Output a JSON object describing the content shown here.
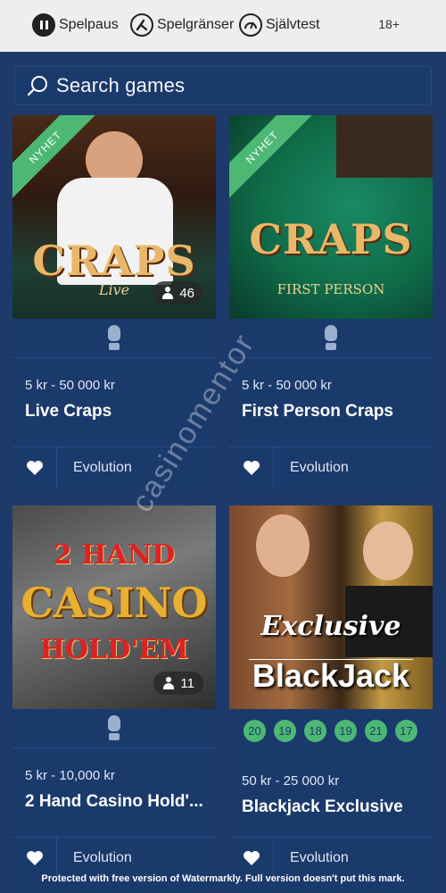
{
  "topbar": {
    "pause_label": "Spelpaus",
    "limits_label": "Spelgränser",
    "selftest_label": "Självtest",
    "age_label": "18+"
  },
  "search": {
    "placeholder": "Search games"
  },
  "badges": {
    "new_label": "NYHET"
  },
  "games": [
    {
      "price": "5 kr - 50 000 kr",
      "name": "Live Craps",
      "provider": "Evolution",
      "players": "46",
      "thumb_title": "CRAPS",
      "thumb_sub": "Live"
    },
    {
      "price": "5 kr - 50 000 kr",
      "name": "First Person Craps",
      "provider": "Evolution",
      "thumb_title": "CRAPS",
      "thumb_sub": "FIRST PERSON"
    },
    {
      "price": "5 kr - 10,000 kr",
      "name": "2 Hand Casino Hold'...",
      "provider": "Evolution",
      "players": "11",
      "thumb_line1": "2 HAND",
      "thumb_line2": "CASINO",
      "thumb_line3": "HOLD'EM"
    },
    {
      "price": "50 kr - 25 000 kr",
      "name": "Blackjack Exclusive",
      "provider": "Evolution",
      "thumb_line1": "Exclusive",
      "thumb_line2": "BlackJack",
      "seats": [
        "20",
        "19",
        "18",
        "19",
        "21",
        "17"
      ]
    }
  ],
  "watermark": {
    "footer": "Protected with free version of Watermarkly. Full version doesn't put this mark.",
    "diagonal": "casinomentor"
  },
  "colors": {
    "background": "#1d3a6b",
    "card": "#1b3a6c",
    "accent_green": "#4cb874",
    "topbar": "#eeeeee"
  }
}
